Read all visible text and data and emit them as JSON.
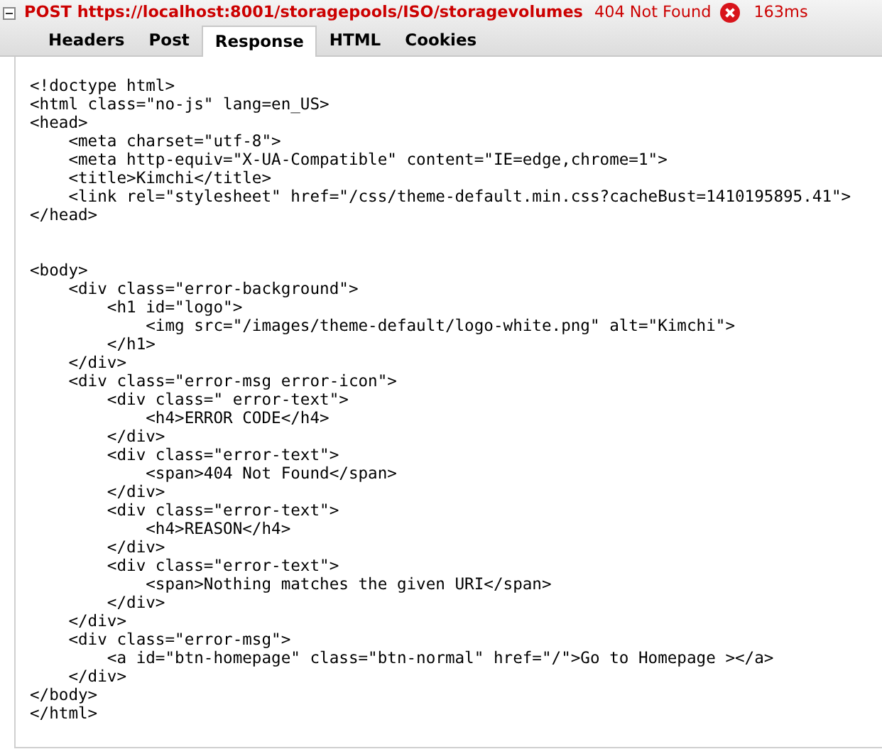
{
  "request": {
    "expanded": true,
    "method": "POST",
    "url": "https://localhost:8001/storagepools/ISO/storagevolumes",
    "status": "404 Not Found",
    "error": true,
    "time": "163ms"
  },
  "tabs": [
    {
      "label": "Headers",
      "selected": false
    },
    {
      "label": "Post",
      "selected": false
    },
    {
      "label": "Response",
      "selected": true
    },
    {
      "label": "HTML",
      "selected": false
    },
    {
      "label": "Cookies",
      "selected": false
    }
  ],
  "response_blocks": [
    [
      "<!doctype html>",
      "<html class=\"no-js\" lang=en_US>",
      "<head>",
      "    <meta charset=\"utf-8\">",
      "    <meta http-equiv=\"X-UA-Compatible\" content=\"IE=edge,chrome=1\">",
      "    <title>Kimchi</title>",
      "    <link rel=\"stylesheet\" href=\"/css/theme-default.min.css?cacheBust=1410195895.41\">",
      "</head>"
    ],
    [
      "<body>",
      "    <div class=\"error-background\">",
      "        <h1 id=\"logo\">",
      "            <img src=\"/images/theme-default/logo-white.png\" alt=\"Kimchi\">",
      "        </h1>",
      "    </div>",
      "    <div class=\"error-msg error-icon\">",
      "        <div class=\" error-text\">",
      "            <h4>ERROR CODE</h4>",
      "        </div>",
      "        <div class=\"error-text\">",
      "            <span>404 Not Found</span>",
      "        </div>",
      "        <div class=\"error-text\">",
      "            <h4>REASON</h4>",
      "        </div>",
      "        <div class=\"error-text\">",
      "            <span>Nothing matches the given URI</span>",
      "        </div>",
      "    </div>",
      "    <div class=\"error-msg\">",
      "        <a id=\"btn-homepage\" class=\"btn-normal\" href=\"/\">Go to Homepage ></a>",
      "    </div>",
      "</body>",
      "</html>"
    ]
  ]
}
